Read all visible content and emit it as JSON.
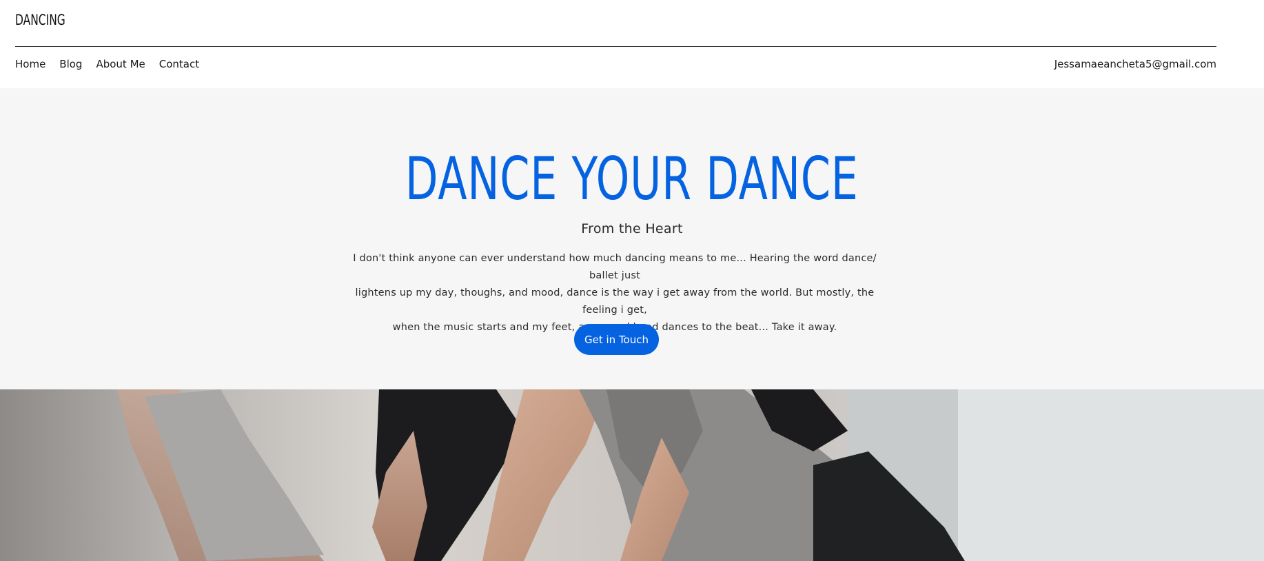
{
  "header": {
    "logo": "DANCING",
    "nav": [
      "Home",
      "Blog",
      "About Me",
      "Contact"
    ],
    "email": "Jessamaeancheta5@gmail.com"
  },
  "hero": {
    "title": "DANCE YOUR DANCE",
    "subtitle": "From the Heart",
    "body_lines": [
      "I don't think anyone can ever understand how much dancing means to me... Hearing the word dance/ ballet just",
      "lightens up my day, thoughs, and mood, dance is the way i get away from the world. But mostly, the feeling i get,",
      "when the music starts and my feet, arms, and head dances to the beat... Take it away."
    ],
    "cta_label": "Get in Touch"
  },
  "colors": {
    "accent": "#0563e2",
    "hero_background": "#f6f6f6"
  },
  "image": {
    "subject": "dancers-stretching-photo"
  }
}
